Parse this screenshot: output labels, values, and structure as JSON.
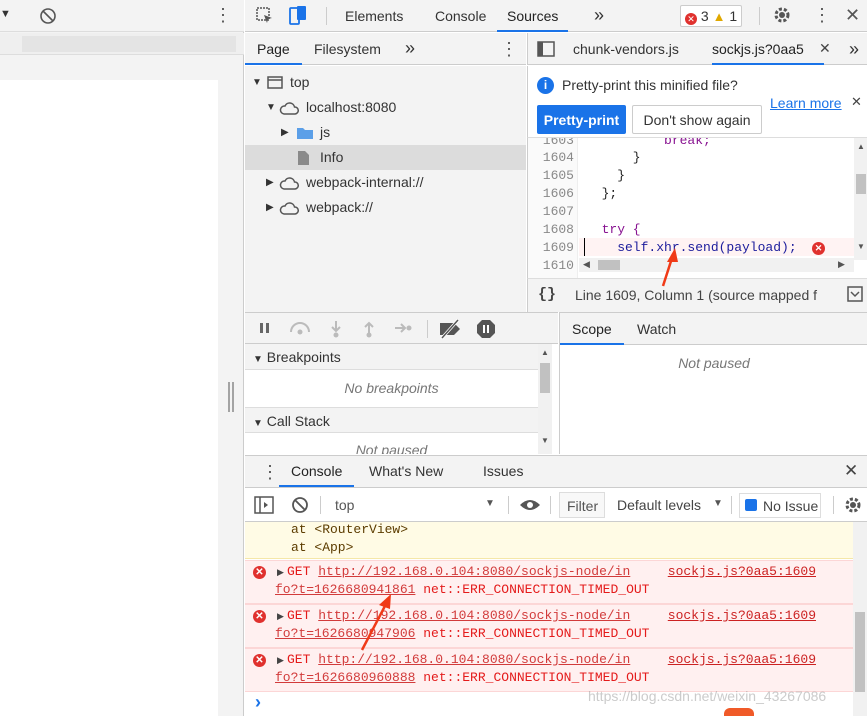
{
  "devtools": {
    "main_tabs": [
      "Elements",
      "Console",
      "Sources"
    ],
    "active_tab": "Sources",
    "error_count": "3",
    "warning_count": "1"
  },
  "navigator": {
    "tabs": [
      "Page",
      "Filesystem"
    ],
    "tree": [
      {
        "label": "top",
        "icon": "frame-icon"
      },
      {
        "label": "localhost:8080",
        "icon": "cloud-icon"
      },
      {
        "label": "js",
        "icon": "folder-icon"
      },
      {
        "label": "Info",
        "icon": "file-icon"
      },
      {
        "label": "webpack-internal://",
        "icon": "cloud-icon"
      },
      {
        "label": "webpack://",
        "icon": "cloud-icon"
      }
    ]
  },
  "editor": {
    "file_tabs": [
      "chunk-vendors.js",
      "sockjs.js?0aa5"
    ],
    "pretty_print_prompt": "Pretty-print this minified file?",
    "pretty_print_button": "Pretty-print",
    "dont_show_button": "Don't show again",
    "learn_more": "Learn more",
    "code_lines": [
      {
        "num": "1603",
        "code": "          break;"
      },
      {
        "num": "1604",
        "code": "      }"
      },
      {
        "num": "1605",
        "code": "    }"
      },
      {
        "num": "1606",
        "code": "  };"
      },
      {
        "num": "1607",
        "code": ""
      },
      {
        "num": "1608",
        "code": "  try {"
      },
      {
        "num": "1609",
        "code": "    self.xhr.send(payload);"
      },
      {
        "num": "1610",
        "code": ""
      }
    ],
    "status_text": "Line 1609, Column 1  (source mapped f"
  },
  "debugger": {
    "breakpoints_title": "Breakpoints",
    "no_breakpoints": "No breakpoints",
    "call_stack_title": "Call Stack",
    "not_paused": "Not paused",
    "scope_tabs": [
      "Scope",
      "Watch"
    ],
    "scope_not_paused": "Not paused"
  },
  "drawer": {
    "tabs": [
      "Console",
      "What's New",
      "Issues"
    ],
    "context": "top",
    "filter_placeholder": "Filter",
    "levels": "Default levels",
    "issues_label": "No Issue"
  },
  "console": {
    "warn_lines": [
      "at <RouterView>",
      "at <App>"
    ],
    "errors": [
      {
        "method": "GET",
        "url": "http://192.168.0.104:8080/sockjs-node/in",
        "url_cont": "fo?t=1626680941861",
        "error": "net::ERR_CONNECTION_TIMED_OUT",
        "source": "sockjs.js?0aa5:1609"
      },
      {
        "method": "GET",
        "url": "http://192.168.0.104:8080/sockjs-node/in",
        "url_cont": "fo?t=1626680947906",
        "error": "net::ERR_CONNECTION_TIMED_OUT",
        "source": "sockjs.js?0aa5:1609"
      },
      {
        "method": "GET",
        "url": "http://192.168.0.104:8080/sockjs-node/in",
        "url_cont": "fo?t=1626680960888",
        "error": "net::ERR_CONNECTION_TIMED_OUT",
        "source": "sockjs.js?0aa5:1609"
      }
    ],
    "prompt": "›"
  },
  "watermark": "https://blog.csdn.net/weixin_43267086",
  "colors": {
    "accent": "#1a73e8",
    "error": "#e0312e",
    "annotation_arrow": "#f03a17"
  }
}
